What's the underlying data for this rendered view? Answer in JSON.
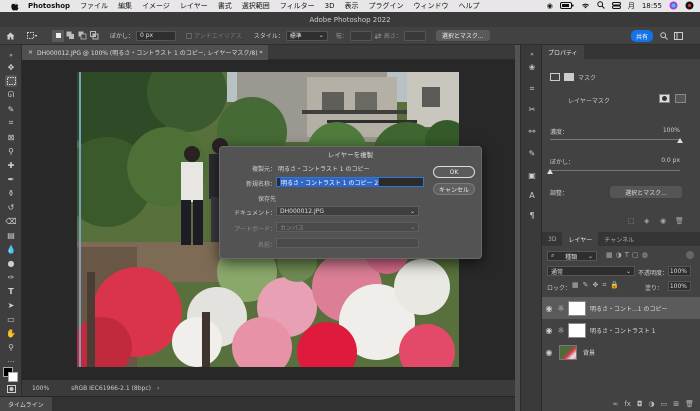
{
  "menubar": {
    "app": "Photoshop",
    "items": [
      "ファイル",
      "編集",
      "イメージ",
      "レイヤー",
      "書式",
      "選択範囲",
      "フィルター",
      "3D",
      "表示",
      "プラグイン",
      "ウィンドウ",
      "ヘルプ"
    ],
    "day": "月",
    "time": "18:55"
  },
  "window": {
    "title": "Adobe Photoshop 2022"
  },
  "options": {
    "feather_label": "ぼかし：",
    "feather_value": "0 px",
    "antialias": "アンチエイリアス",
    "style_label": "スタイル：",
    "style_value": "標準",
    "width_label": "幅：",
    "height_label": "高さ：",
    "select_mask": "選択とマスク...",
    "share": "共有"
  },
  "document": {
    "tab_title": "DH000012.JPG @ 100% (明るさ・コントラスト 1 のコピー, レイヤーマスク/8) *",
    "close": "×"
  },
  "status": {
    "zoom": "100%",
    "profile": "sRGB IEC61966-2.1 (8bpc)",
    "arrow": "›"
  },
  "timeline": {
    "label": "タイムライン"
  },
  "properties": {
    "tab": "プロパティ",
    "mask_label": "マスク",
    "layer_mask": "レイヤーマスク",
    "density_label": "濃度：",
    "density_value": "100%",
    "density": 1.0,
    "feather_label": "ぼかし：",
    "feather_value": "0.0 px",
    "feather": 0.0,
    "refine_label": "調整：",
    "refine_button": "選択とマスク..."
  },
  "layers_panel": {
    "tabs": [
      "3D",
      "レイヤー",
      "チャンネル"
    ],
    "search": "種類",
    "blend": "通常",
    "opacity_label": "不透明度：",
    "opacity_value": "100%",
    "lock_label": "ロック：",
    "fill_label": "塗り：",
    "fill_value": "100%",
    "layers": [
      {
        "name": "明るさ・コント...1 のコピー",
        "selected": true,
        "type": "adjustment"
      },
      {
        "name": "明るさ・コントラスト 1",
        "selected": false,
        "type": "adjustment"
      },
      {
        "name": "背景",
        "selected": false,
        "type": "image"
      }
    ]
  },
  "dialog": {
    "title": "レイヤーを複製",
    "source_label": "複製元：",
    "source_value": "明るさ・コントラスト 1 のコピー",
    "as_label": "新規名称：",
    "as_value": "明るさ・コントラスト 1 のコピー 2",
    "dest_label": "保存先",
    "doc_label": "ドキュメント：",
    "doc_value": "DH000012.JPG",
    "artboard_label": "アートボード：",
    "artboard_value": "カンバス",
    "name_label": "名前：",
    "ok": "OK",
    "cancel": "キャンセル"
  }
}
